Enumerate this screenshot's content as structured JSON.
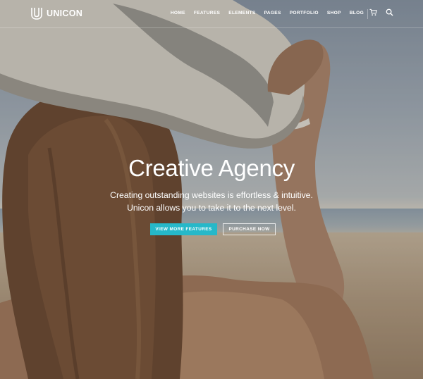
{
  "brand": {
    "name": "UNICON"
  },
  "nav": {
    "items": [
      "HOME",
      "FEATURES",
      "ELEMENTS",
      "PAGES",
      "PORTFOLIO",
      "SHOP",
      "BLOG"
    ],
    "icons": [
      "cart-icon",
      "search-icon"
    ]
  },
  "hero": {
    "title": "Creative Agency",
    "subtitle_line1": "Creating outstanding websites is effortless & intuitive.",
    "subtitle_line2": "Unicon allows you to take it to the next level.",
    "primary_button": "VIEW MORE FEATURES",
    "secondary_button": "PURCHASE NOW"
  },
  "colors": {
    "accent": "#26b8c9",
    "text": "#ffffff"
  }
}
